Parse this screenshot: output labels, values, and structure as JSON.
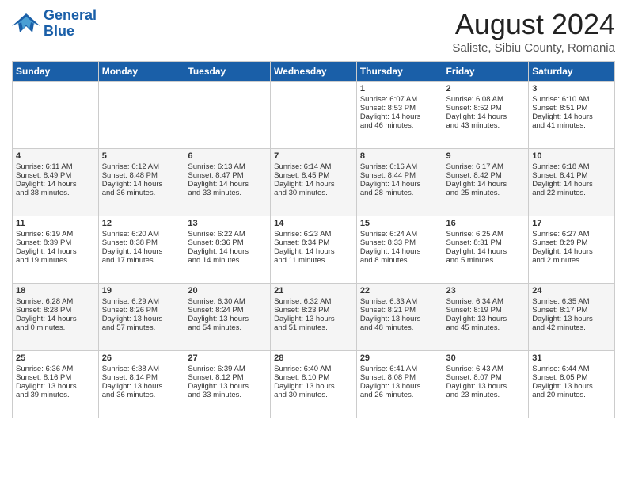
{
  "header": {
    "logo_line1": "General",
    "logo_line2": "Blue",
    "month_year": "August 2024",
    "location": "Saliste, Sibiu County, Romania"
  },
  "weekdays": [
    "Sunday",
    "Monday",
    "Tuesday",
    "Wednesday",
    "Thursday",
    "Friday",
    "Saturday"
  ],
  "weeks": [
    [
      {
        "day": "",
        "lines": []
      },
      {
        "day": "",
        "lines": []
      },
      {
        "day": "",
        "lines": []
      },
      {
        "day": "",
        "lines": []
      },
      {
        "day": "1",
        "lines": [
          "Sunrise: 6:07 AM",
          "Sunset: 8:53 PM",
          "Daylight: 14 hours",
          "and 46 minutes."
        ]
      },
      {
        "day": "2",
        "lines": [
          "Sunrise: 6:08 AM",
          "Sunset: 8:52 PM",
          "Daylight: 14 hours",
          "and 43 minutes."
        ]
      },
      {
        "day": "3",
        "lines": [
          "Sunrise: 6:10 AM",
          "Sunset: 8:51 PM",
          "Daylight: 14 hours",
          "and 41 minutes."
        ]
      }
    ],
    [
      {
        "day": "4",
        "lines": [
          "Sunrise: 6:11 AM",
          "Sunset: 8:49 PM",
          "Daylight: 14 hours",
          "and 38 minutes."
        ]
      },
      {
        "day": "5",
        "lines": [
          "Sunrise: 6:12 AM",
          "Sunset: 8:48 PM",
          "Daylight: 14 hours",
          "and 36 minutes."
        ]
      },
      {
        "day": "6",
        "lines": [
          "Sunrise: 6:13 AM",
          "Sunset: 8:47 PM",
          "Daylight: 14 hours",
          "and 33 minutes."
        ]
      },
      {
        "day": "7",
        "lines": [
          "Sunrise: 6:14 AM",
          "Sunset: 8:45 PM",
          "Daylight: 14 hours",
          "and 30 minutes."
        ]
      },
      {
        "day": "8",
        "lines": [
          "Sunrise: 6:16 AM",
          "Sunset: 8:44 PM",
          "Daylight: 14 hours",
          "and 28 minutes."
        ]
      },
      {
        "day": "9",
        "lines": [
          "Sunrise: 6:17 AM",
          "Sunset: 8:42 PM",
          "Daylight: 14 hours",
          "and 25 minutes."
        ]
      },
      {
        "day": "10",
        "lines": [
          "Sunrise: 6:18 AM",
          "Sunset: 8:41 PM",
          "Daylight: 14 hours",
          "and 22 minutes."
        ]
      }
    ],
    [
      {
        "day": "11",
        "lines": [
          "Sunrise: 6:19 AM",
          "Sunset: 8:39 PM",
          "Daylight: 14 hours",
          "and 19 minutes."
        ]
      },
      {
        "day": "12",
        "lines": [
          "Sunrise: 6:20 AM",
          "Sunset: 8:38 PM",
          "Daylight: 14 hours",
          "and 17 minutes."
        ]
      },
      {
        "day": "13",
        "lines": [
          "Sunrise: 6:22 AM",
          "Sunset: 8:36 PM",
          "Daylight: 14 hours",
          "and 14 minutes."
        ]
      },
      {
        "day": "14",
        "lines": [
          "Sunrise: 6:23 AM",
          "Sunset: 8:34 PM",
          "Daylight: 14 hours",
          "and 11 minutes."
        ]
      },
      {
        "day": "15",
        "lines": [
          "Sunrise: 6:24 AM",
          "Sunset: 8:33 PM",
          "Daylight: 14 hours",
          "and 8 minutes."
        ]
      },
      {
        "day": "16",
        "lines": [
          "Sunrise: 6:25 AM",
          "Sunset: 8:31 PM",
          "Daylight: 14 hours",
          "and 5 minutes."
        ]
      },
      {
        "day": "17",
        "lines": [
          "Sunrise: 6:27 AM",
          "Sunset: 8:29 PM",
          "Daylight: 14 hours",
          "and 2 minutes."
        ]
      }
    ],
    [
      {
        "day": "18",
        "lines": [
          "Sunrise: 6:28 AM",
          "Sunset: 8:28 PM",
          "Daylight: 14 hours",
          "and 0 minutes."
        ]
      },
      {
        "day": "19",
        "lines": [
          "Sunrise: 6:29 AM",
          "Sunset: 8:26 PM",
          "Daylight: 13 hours",
          "and 57 minutes."
        ]
      },
      {
        "day": "20",
        "lines": [
          "Sunrise: 6:30 AM",
          "Sunset: 8:24 PM",
          "Daylight: 13 hours",
          "and 54 minutes."
        ]
      },
      {
        "day": "21",
        "lines": [
          "Sunrise: 6:32 AM",
          "Sunset: 8:23 PM",
          "Daylight: 13 hours",
          "and 51 minutes."
        ]
      },
      {
        "day": "22",
        "lines": [
          "Sunrise: 6:33 AM",
          "Sunset: 8:21 PM",
          "Daylight: 13 hours",
          "and 48 minutes."
        ]
      },
      {
        "day": "23",
        "lines": [
          "Sunrise: 6:34 AM",
          "Sunset: 8:19 PM",
          "Daylight: 13 hours",
          "and 45 minutes."
        ]
      },
      {
        "day": "24",
        "lines": [
          "Sunrise: 6:35 AM",
          "Sunset: 8:17 PM",
          "Daylight: 13 hours",
          "and 42 minutes."
        ]
      }
    ],
    [
      {
        "day": "25",
        "lines": [
          "Sunrise: 6:36 AM",
          "Sunset: 8:16 PM",
          "Daylight: 13 hours",
          "and 39 minutes."
        ]
      },
      {
        "day": "26",
        "lines": [
          "Sunrise: 6:38 AM",
          "Sunset: 8:14 PM",
          "Daylight: 13 hours",
          "and 36 minutes."
        ]
      },
      {
        "day": "27",
        "lines": [
          "Sunrise: 6:39 AM",
          "Sunset: 8:12 PM",
          "Daylight: 13 hours",
          "and 33 minutes."
        ]
      },
      {
        "day": "28",
        "lines": [
          "Sunrise: 6:40 AM",
          "Sunset: 8:10 PM",
          "Daylight: 13 hours",
          "and 30 minutes."
        ]
      },
      {
        "day": "29",
        "lines": [
          "Sunrise: 6:41 AM",
          "Sunset: 8:08 PM",
          "Daylight: 13 hours",
          "and 26 minutes."
        ]
      },
      {
        "day": "30",
        "lines": [
          "Sunrise: 6:43 AM",
          "Sunset: 8:07 PM",
          "Daylight: 13 hours",
          "and 23 minutes."
        ]
      },
      {
        "day": "31",
        "lines": [
          "Sunrise: 6:44 AM",
          "Sunset: 8:05 PM",
          "Daylight: 13 hours",
          "and 20 minutes."
        ]
      }
    ]
  ]
}
